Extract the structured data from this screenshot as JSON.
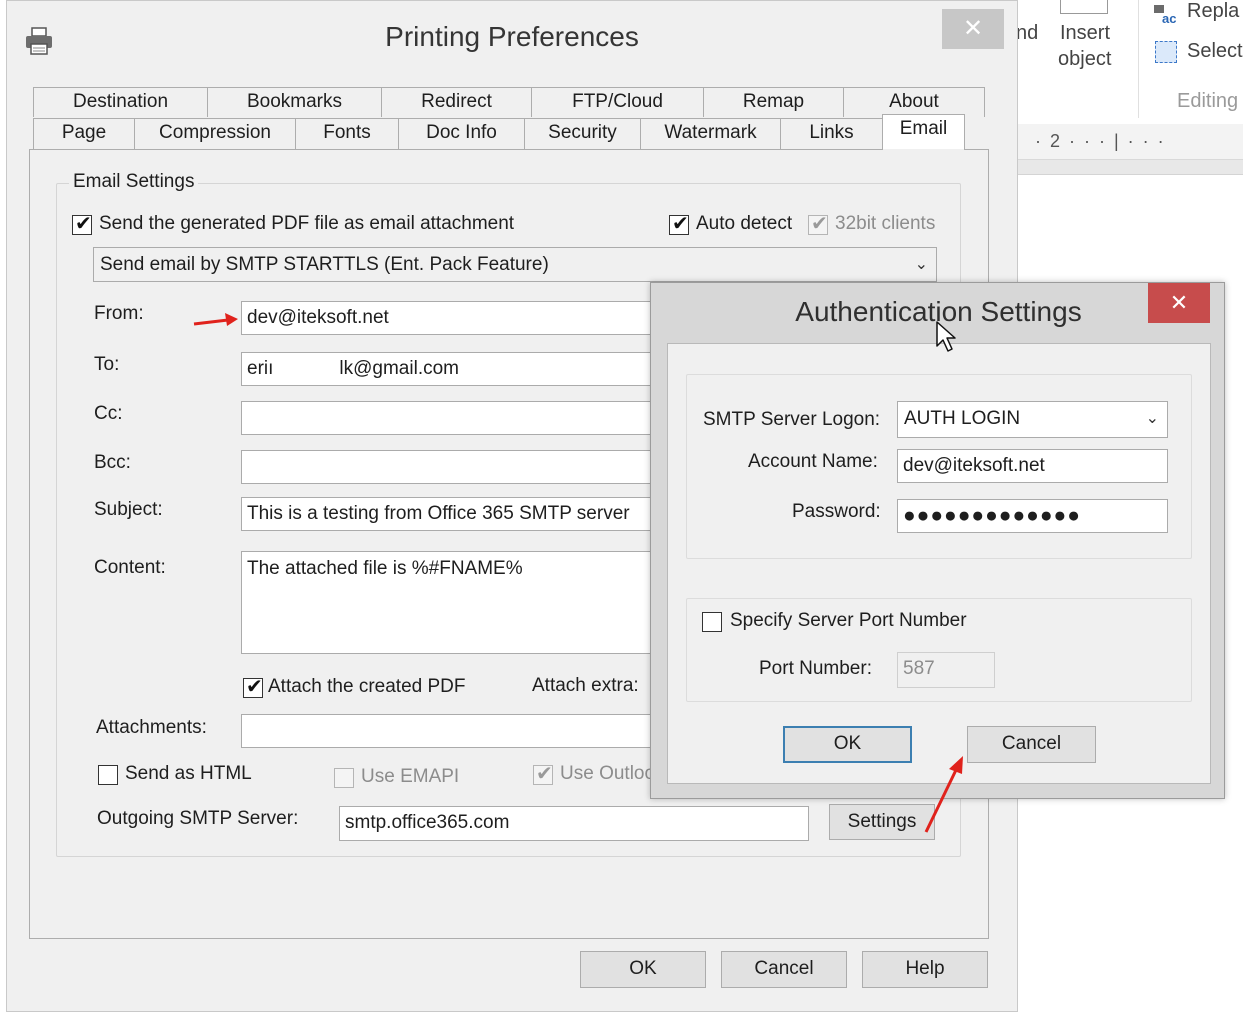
{
  "background_app": {
    "find_label": "nd",
    "insert_object_line1": "Insert",
    "insert_object_line2": "object",
    "replace_label": "Repla",
    "select_label": "Select",
    "editing_label": "Editing",
    "ruler_marker": "· 2 · · · | · · ·"
  },
  "dialog": {
    "title": "Printing Preferences",
    "close_glyph": "✕",
    "tabs_row1": [
      "Destination",
      "Bookmarks",
      "Redirect",
      "FTP/Cloud",
      "Remap",
      "About"
    ],
    "tabs_row2": [
      "Page",
      "Compression",
      "Fonts",
      "Doc Info",
      "Security",
      "Watermark",
      "Links",
      "Email"
    ],
    "active_tab": "Email",
    "ok_label": "OK",
    "cancel_label": "Cancel",
    "help_label": "Help"
  },
  "email": {
    "group_title": "Email Settings",
    "send_attachment_label": "Send the generated PDF file as email attachment",
    "send_attachment_checked": true,
    "auto_detect_label": "Auto detect",
    "auto_detect_checked": true,
    "clients32_label": "32bit clients",
    "clients32_checked": true,
    "method_select": "Send email by SMTP STARTTLS (Ent. Pack Feature)",
    "from_label": "From:",
    "from_value": "dev@iteksoft.net",
    "to_label": "To:",
    "to_value_part1": "eriı",
    "to_value_part2": "lk@gmail.com",
    "cc_label": "Cc:",
    "cc_value": "",
    "bcc_label": "Bcc:",
    "bcc_value": "",
    "subject_label": "Subject:",
    "subject_value": "This is a testing from Office 365 SMTP server",
    "content_label": "Content:",
    "content_value": "The attached file is %#FNAME%",
    "attach_created_label": "Attach the created PDF",
    "attach_created_checked": true,
    "attach_extra_label": "Attach extra:",
    "attachments_label": "Attachments:",
    "attachments_value": "",
    "send_html_label": "Send as HTML",
    "send_html_checked": false,
    "use_emapi_label": "Use EMAPI",
    "use_emapi_checked": false,
    "use_outlook_label": "Use Outloo",
    "use_outlook_checked": true,
    "smtp_server_label": "Outgoing SMTP Server:",
    "smtp_server_value": "smtp.office365.com",
    "settings_button": "Settings"
  },
  "auth": {
    "title": "Authentication Settings",
    "close_glyph": "✕",
    "logon_label": "SMTP Server Logon:",
    "logon_value": "AUTH LOGIN",
    "account_label": "Account Name:",
    "account_value": "dev@iteksoft.net",
    "password_label": "Password:",
    "password_value": "●●●●●●●●●●●●●",
    "specify_port_label": "Specify Server Port Number",
    "specify_port_checked": false,
    "port_label": "Port Number:",
    "port_value": "587",
    "ok_label": "OK",
    "cancel_label": "Cancel"
  },
  "icons": {
    "printer": "printer-icon",
    "checkmark": "✔",
    "dropdown": "⌄",
    "cursor": "cursor-icon",
    "arrow_color": "#e0221c"
  }
}
